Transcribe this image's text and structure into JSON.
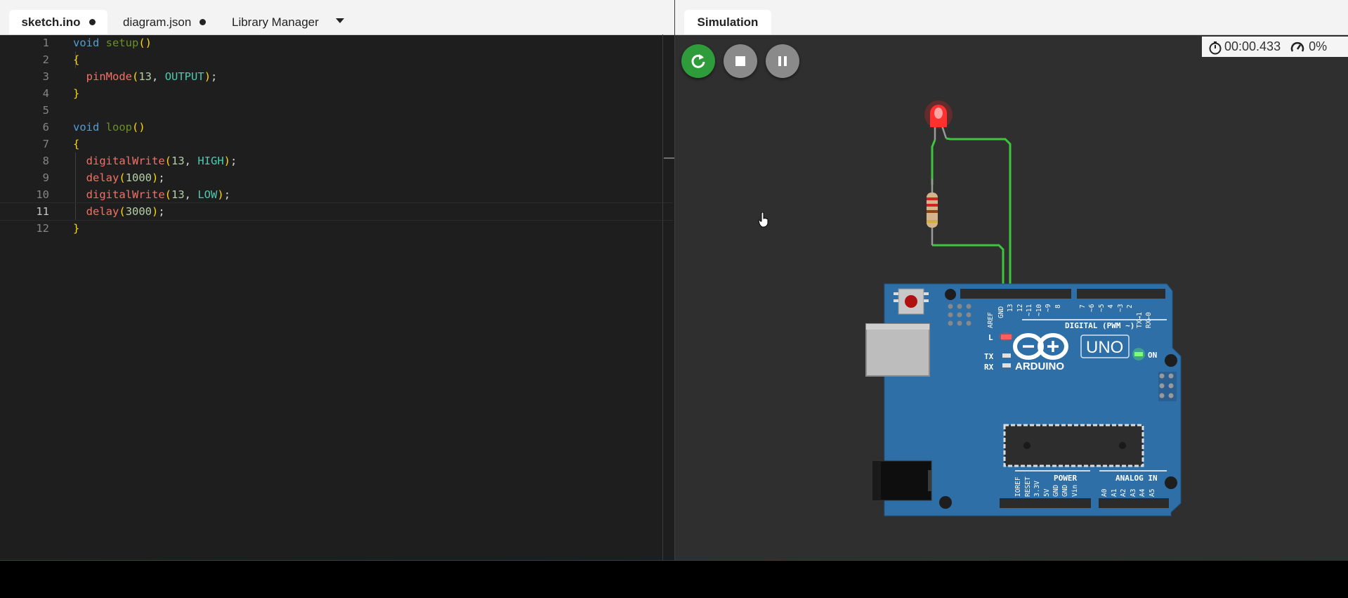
{
  "editor": {
    "tabs": [
      {
        "label": "sketch.ino",
        "modified": true,
        "active": true
      },
      {
        "label": "diagram.json",
        "modified": true,
        "active": false
      },
      {
        "label": "Library Manager",
        "modified": false,
        "active": false
      }
    ],
    "current_line": 11,
    "lines": [
      {
        "n": "1"
      },
      {
        "n": "2"
      },
      {
        "n": "3"
      },
      {
        "n": "4"
      },
      {
        "n": "5"
      },
      {
        "n": "6"
      },
      {
        "n": "7"
      },
      {
        "n": "8"
      },
      {
        "n": "9"
      },
      {
        "n": "10"
      },
      {
        "n": "11"
      },
      {
        "n": "12"
      }
    ],
    "code": [
      "void setup()",
      "{",
      "  pinMode(13, OUTPUT);",
      "}",
      "",
      "void loop()",
      "{",
      "  digitalWrite(13, HIGH);",
      "  delay(1000);",
      "  digitalWrite(13, LOW);",
      "  delay(3000);",
      "}"
    ]
  },
  "simulation": {
    "tab_label": "Simulation",
    "controls": [
      "restart-icon",
      "stop-icon",
      "pause-icon"
    ],
    "timer": "00:00.433",
    "speed": "0%",
    "colors": {
      "restart": "#2e9c3a",
      "wire": "#3ec43e",
      "board": "#2f6fa7",
      "led": "#ff3030"
    },
    "board": {
      "brand": "ARDUINO",
      "model": "UNO",
      "labels": {
        "digital": "DIGITAL (PWM ~)",
        "analog": "ANALOG IN",
        "power": "POWER",
        "on": "ON",
        "l": "L",
        "tx": "TX",
        "rx": "RX"
      },
      "digital_pins": [
        "AREF",
        "GND",
        "13",
        "12",
        "~11",
        "~10",
        "~9",
        "8",
        "7",
        "~6",
        "~5",
        "4",
        "~3",
        "2",
        "TX→1",
        "RX←0"
      ],
      "power_pins": [
        "IOREF",
        "RESET",
        "3.3V",
        "5V",
        "GND",
        "GND",
        "Vin"
      ],
      "analog_pins": [
        "A0",
        "A1",
        "A2",
        "A3",
        "A4",
        "A5"
      ]
    }
  }
}
